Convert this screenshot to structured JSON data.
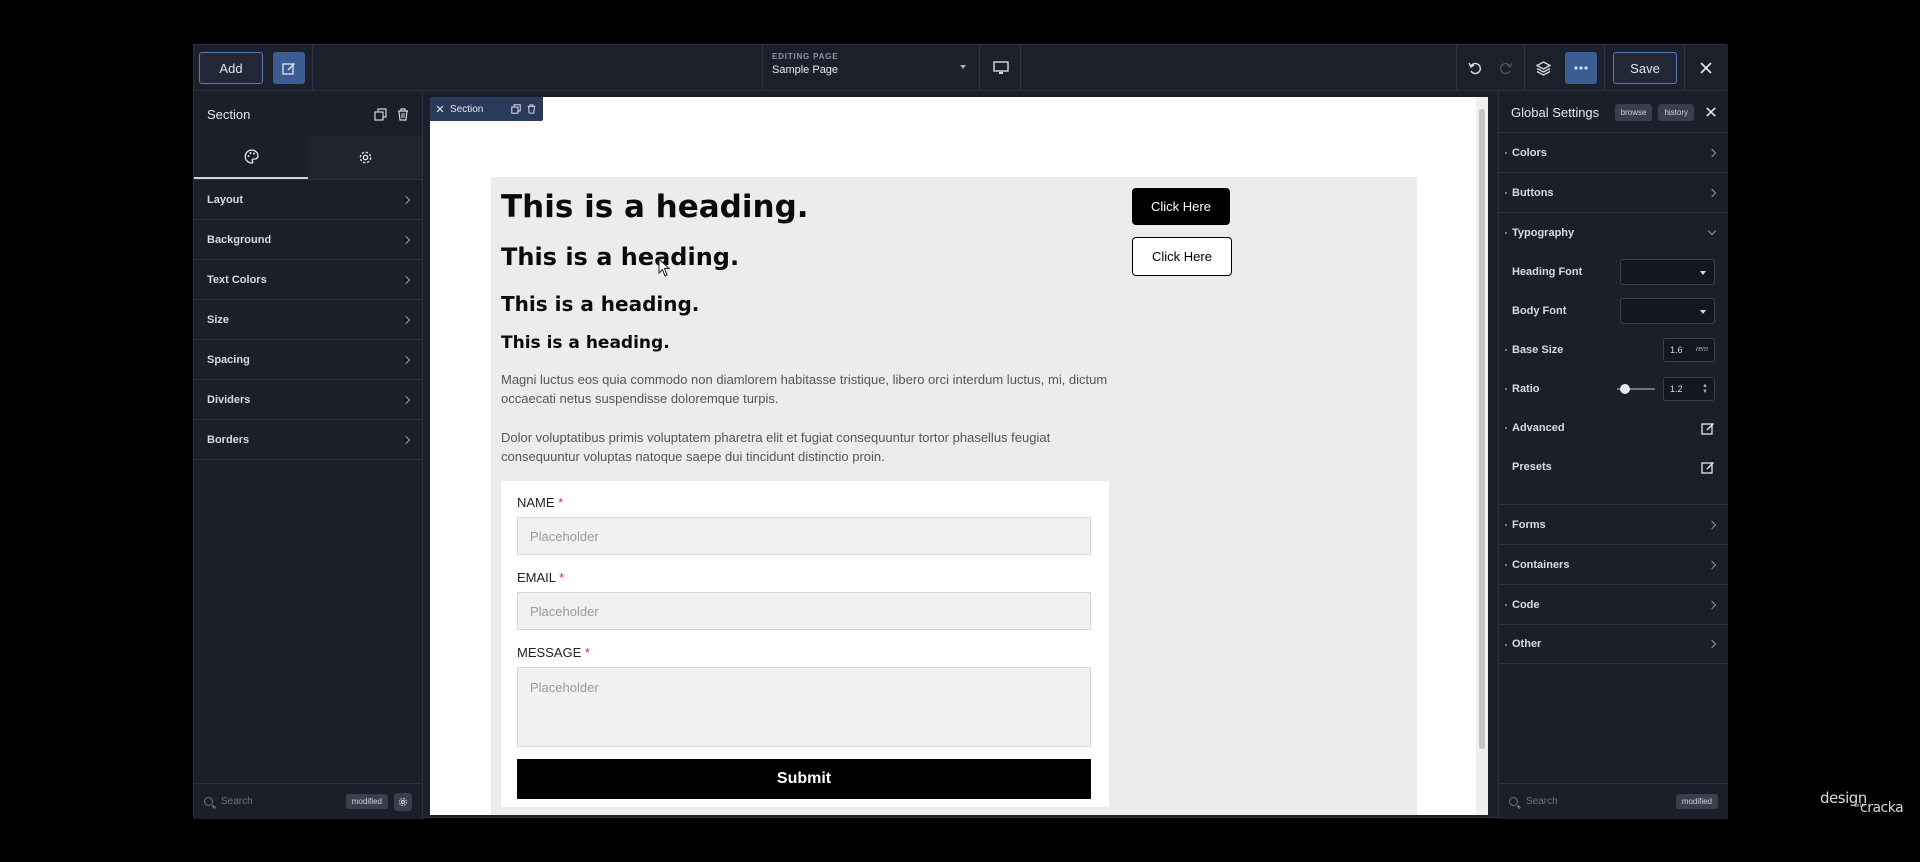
{
  "topbar": {
    "add_label": "Add",
    "editing_label": "EDITING PAGE",
    "page_name": "Sample Page",
    "save_label": "Save"
  },
  "left_panel": {
    "title": "Section",
    "items": [
      "Layout",
      "Background",
      "Text Colors",
      "Size",
      "Spacing",
      "Dividers",
      "Borders"
    ],
    "search_placeholder": "Search",
    "badge": "modified"
  },
  "canvas": {
    "section_tag": "Section",
    "headings": [
      "This is a heading.",
      "This is a heading.",
      "This is a heading.",
      "This is a heading."
    ],
    "paragraph1": "Magni luctus eos quia commodo non diamlorem habitasse tristique, libero orci interdum luctus, mi, dictum occaecati netus suspendisse doloremque turpis.",
    "paragraph2": "Dolor voluptatibus primis voluptatem pharetra elit et fugiat consequuntur tortor phasellus feugiat consequuntur voluptas natoque saepe dui tincidunt distinctio proin.",
    "button_solid": "Click Here",
    "button_outline": "Click Here",
    "form": {
      "name_label": "NAME",
      "email_label": "EMAIL",
      "message_label": "MESSAGE",
      "required_mark": "*",
      "placeholder": "Placeholder",
      "submit_label": "Submit"
    }
  },
  "right_panel": {
    "title": "Global Settings",
    "browse_label": "browse",
    "history_label": "history",
    "sections_top": [
      "Colors",
      "Buttons"
    ],
    "typography": {
      "title": "Typography",
      "heading_font_label": "Heading Font",
      "body_font_label": "Body Font",
      "base_size_label": "Base Size",
      "base_size_value": "1.6",
      "base_size_unit": "rem",
      "ratio_label": "Ratio",
      "ratio_value": "1.2",
      "ratio_slider_fraction": 0.1,
      "advanced_label": "Advanced",
      "presets_label": "Presets"
    },
    "sections_bottom": [
      "Forms",
      "Containers",
      "Code",
      "Other"
    ],
    "search_placeholder": "Search",
    "badge": "modified"
  },
  "watermark": {
    "line1": "design",
    "line2": "with",
    "line3": "cracka"
  }
}
